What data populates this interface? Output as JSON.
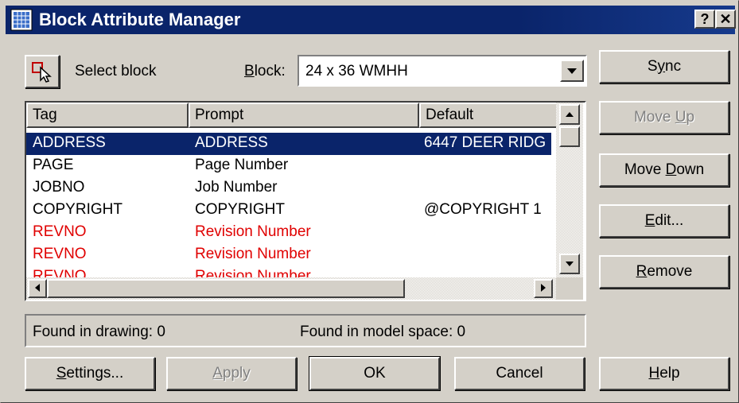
{
  "window": {
    "title": "Block Attribute Manager",
    "help_btn": "?",
    "close_btn": "✕"
  },
  "top": {
    "select_block_label": "Select block",
    "block_label_prefix": "B",
    "block_label_rest": "lock:",
    "block_value": "24 x 36 WMHH"
  },
  "table": {
    "columns": [
      "Tag",
      "Prompt",
      "Default"
    ],
    "rows": [
      {
        "tag": "ADDRESS",
        "prompt": "ADDRESS",
        "default": "6447 DEER RIDG",
        "selected": true,
        "color": "#ffffff"
      },
      {
        "tag": "PAGE",
        "prompt": "Page Number",
        "default": "",
        "selected": false,
        "color": "#000000"
      },
      {
        "tag": "JOBNO",
        "prompt": "Job Number",
        "default": "",
        "selected": false,
        "color": "#000000"
      },
      {
        "tag": "COPYRIGHT",
        "prompt": "COPYRIGHT",
        "default": "@COPYRIGHT 1",
        "selected": false,
        "color": "#000000"
      },
      {
        "tag": "REVNO",
        "prompt": "Revision Number",
        "default": "",
        "selected": false,
        "color": "#e00000"
      },
      {
        "tag": "REVNO",
        "prompt": "Revision Number",
        "default": "",
        "selected": false,
        "color": "#e00000"
      },
      {
        "tag": "REVNO",
        "prompt": "Revision Number",
        "default": "",
        "selected": false,
        "color": "#e00000"
      }
    ]
  },
  "status": {
    "found_in_drawing": "Found in drawing: 0",
    "found_in_model_space": "Found in model space: 0"
  },
  "side_buttons": {
    "sync_pre": "S",
    "sync_ul": "y",
    "sync_post": "nc",
    "move_up_pre": "Move ",
    "move_up_ul": "U",
    "move_up_post": "p",
    "move_down_pre": "Move ",
    "move_down_ul": "D",
    "move_down_post": "own",
    "edit_ul": "E",
    "edit_post": "dit...",
    "remove_ul": "R",
    "remove_post": "emove"
  },
  "bottom_buttons": {
    "settings_ul": "S",
    "settings_post": "ettings...",
    "apply_ul": "A",
    "apply_post": "pply",
    "ok": "OK",
    "cancel": "Cancel",
    "help_ul": "H",
    "help_post": "elp"
  },
  "colors": {
    "titlebar": "#0a246a",
    "selection": "#0a246a",
    "red_text": "#e00000",
    "face": "#d4d0c8"
  }
}
